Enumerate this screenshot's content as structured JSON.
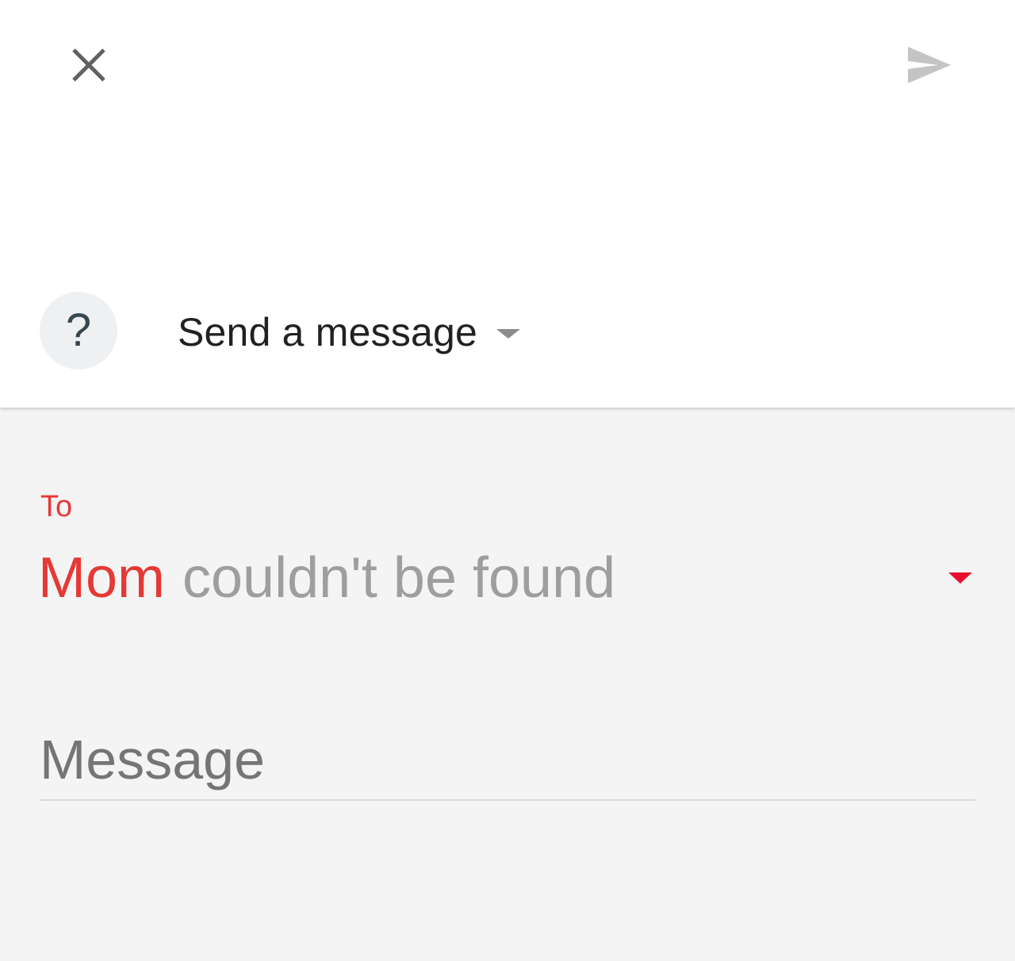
{
  "header": {
    "close_icon": "close-icon",
    "send_icon": "send-icon",
    "send_state": "disabled"
  },
  "action": {
    "help_glyph": "?",
    "label": "Send a message",
    "dropdown_icon": "caret-down-icon"
  },
  "recipient": {
    "label": "To",
    "name": "Mom",
    "status": "couldn't be found",
    "dropdown_icon": "caret-down-icon",
    "error_color": "#e53935"
  },
  "message": {
    "placeholder": "Message",
    "value": ""
  }
}
